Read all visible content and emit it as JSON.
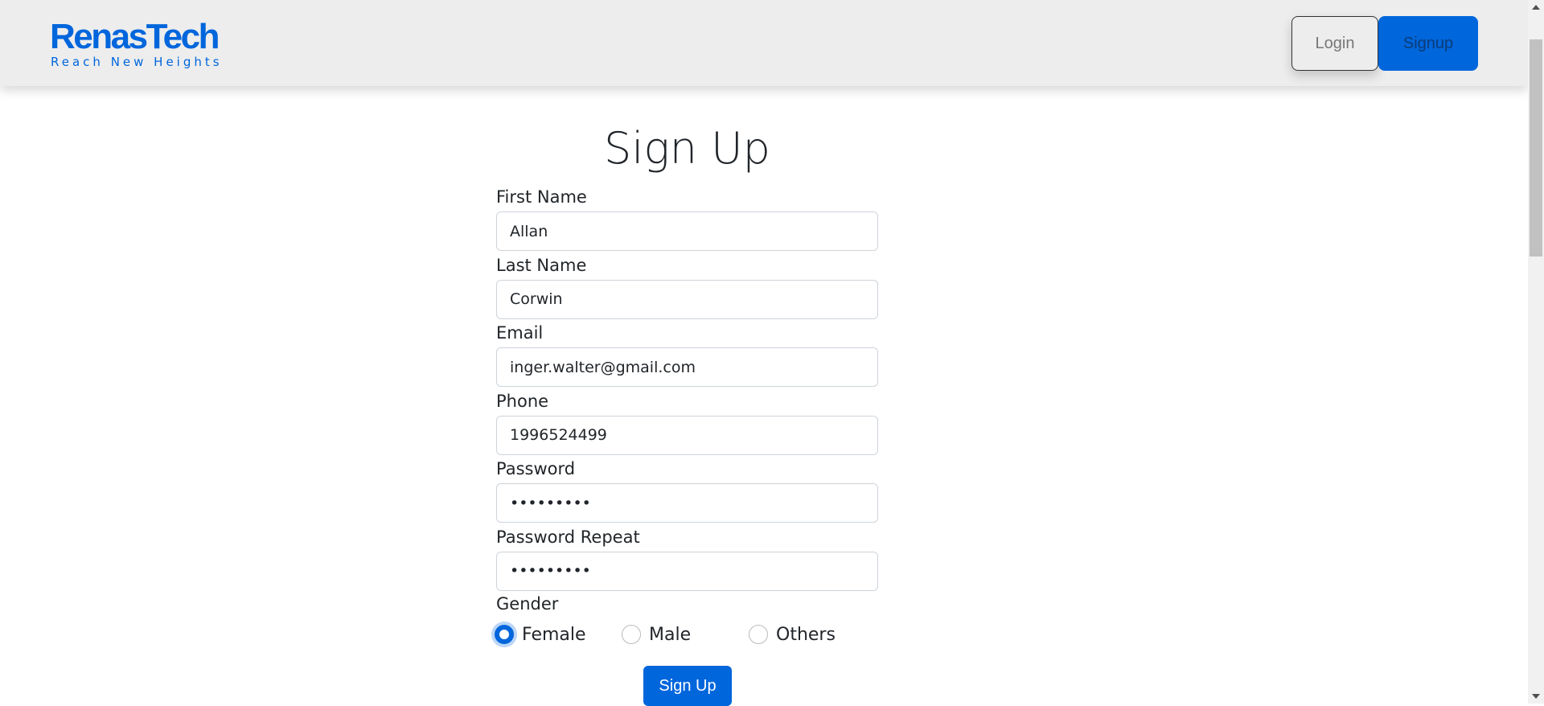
{
  "header": {
    "logo": {
      "name": "RenasTech",
      "tagline": "Reach New Heights"
    },
    "login_label": "Login",
    "signup_label": "Signup"
  },
  "form": {
    "title": "Sign Up",
    "fields": [
      {
        "label": "First Name",
        "value": "Allan",
        "type": "text"
      },
      {
        "label": "Last Name",
        "value": "Corwin",
        "type": "text"
      },
      {
        "label": "Email",
        "value": "inger.walter@gmail.com",
        "type": "email"
      },
      {
        "label": "Phone",
        "value": "1996524499",
        "type": "tel"
      },
      {
        "label": "Password",
        "value": "123456789",
        "type": "password"
      },
      {
        "label": "Password Repeat",
        "value": "123456789",
        "type": "password"
      }
    ],
    "gender": {
      "label": "Gender",
      "options": [
        "Female",
        "Male",
        "Others"
      ],
      "selected": "Female"
    },
    "submit_label": "Sign Up"
  },
  "colors": {
    "primary": "#0066dc",
    "navbar": "#ededed"
  }
}
